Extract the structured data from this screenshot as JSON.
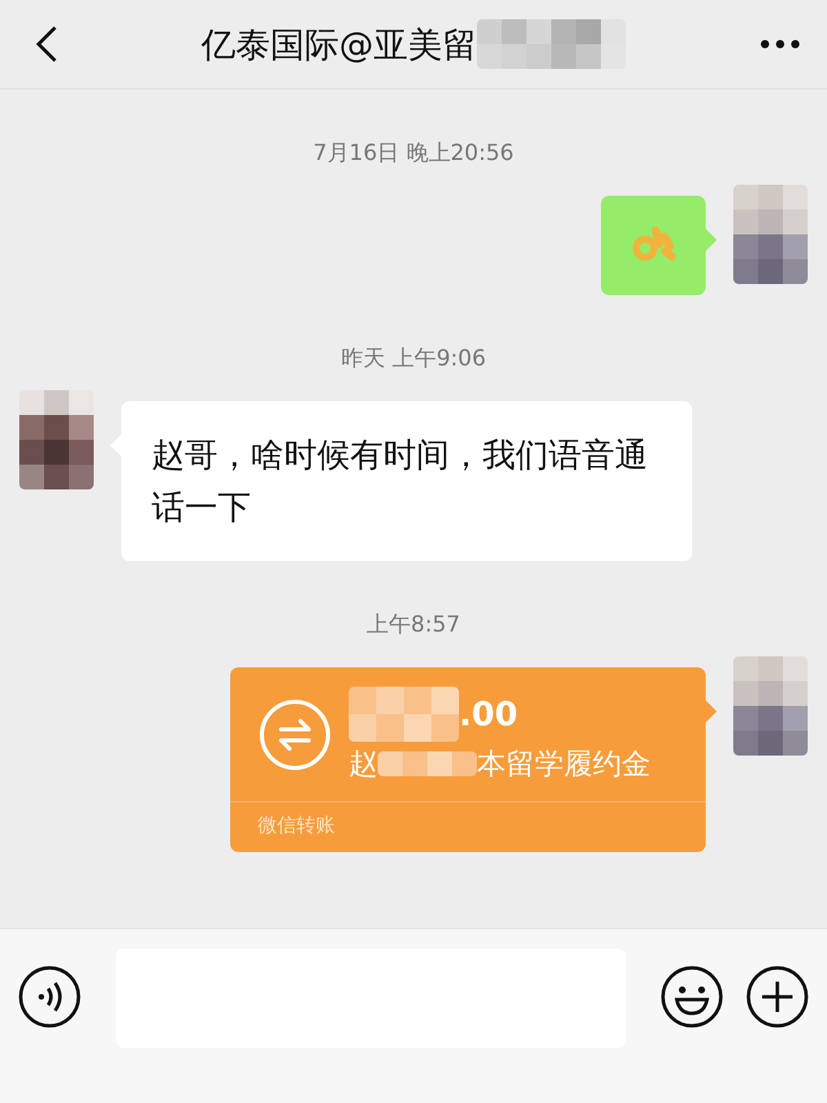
{
  "header": {
    "title": "亿泰国际@亚美留",
    "title_blurred": true
  },
  "messages": [
    {
      "kind": "time",
      "text": "7月16日 晚上20:56"
    },
    {
      "kind": "sticker",
      "outgoing": true
    },
    {
      "kind": "time",
      "text": "昨天 上午9:06"
    },
    {
      "kind": "text",
      "outgoing": false,
      "text": "赵哥，啥时候有时间，我们语音通话一下"
    },
    {
      "kind": "time",
      "text": "上午8:57"
    },
    {
      "kind": "transfer",
      "outgoing": true,
      "amount": ".00",
      "note_start": "赵",
      "note_end": "本留学履约金",
      "footer": "微信转账"
    }
  ]
}
